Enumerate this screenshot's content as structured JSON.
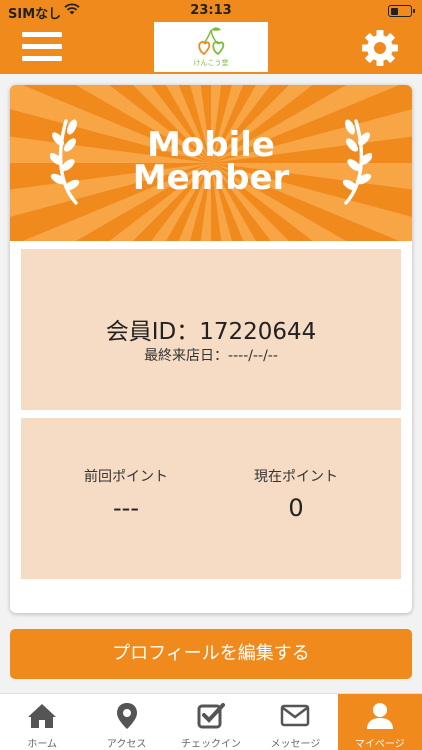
{
  "status_bar": {
    "carrier": "SIMなし",
    "time": "23:13",
    "battery_level": 0.35
  },
  "header": {
    "logo_text": "けんこう堂",
    "menu_icon": "hamburger-menu-icon",
    "settings_icon": "gear-icon"
  },
  "card": {
    "banner_title_line1": "Mobile",
    "banner_title_line2": "Member",
    "member_id": "会員ID：17220644",
    "last_visit": "最終来店日：----/--/--",
    "prev_points_label": "前回ポイント",
    "prev_points_value": "---",
    "current_points_label": "現在ポイント",
    "current_points_value": "0"
  },
  "edit_profile_label": "プロフィールを編集する",
  "tabbar": {
    "items": [
      {
        "label": "ホーム",
        "icon": "home-icon"
      },
      {
        "label": "アクセス",
        "icon": "map-pin-icon"
      },
      {
        "label": "チェックイン",
        "icon": "checkbox-icon"
      },
      {
        "label": "メッセージ",
        "icon": "mail-icon"
      },
      {
        "label": "マイページ",
        "icon": "user-icon",
        "active": true
      }
    ]
  },
  "colors": {
    "accent": "#f08a1c",
    "panel": "#f6dcc5"
  }
}
